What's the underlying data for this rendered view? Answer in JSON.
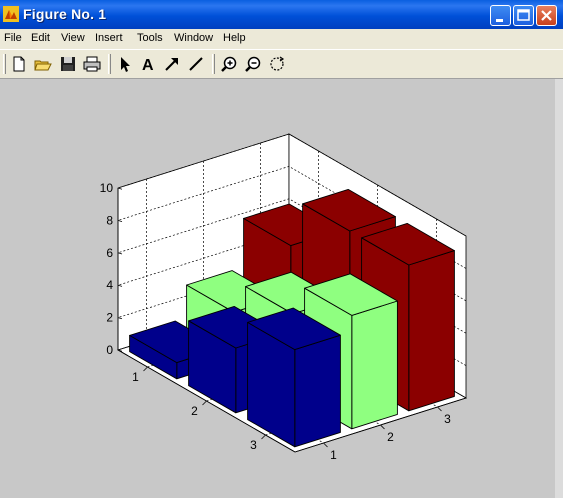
{
  "window": {
    "title": "Figure No. 1",
    "buttons": [
      "minimize",
      "maximize",
      "close"
    ]
  },
  "menu": [
    "File",
    "Edit",
    "View",
    "Insert",
    "Tools",
    "Window",
    "Help"
  ],
  "toolbar": [
    {
      "name": "new-figure-icon",
      "icon": "page"
    },
    {
      "name": "open-file-icon",
      "icon": "folder"
    },
    {
      "name": "save-icon",
      "icon": "floppy"
    },
    {
      "name": "print-icon",
      "icon": "printer"
    },
    {
      "name": "edit-plot-icon",
      "icon": "arrow-pointer"
    },
    {
      "name": "insert-text-icon",
      "icon": "letter-a"
    },
    {
      "name": "insert-arrow-icon",
      "icon": "diagonal-arrow"
    },
    {
      "name": "insert-line-icon",
      "icon": "line"
    },
    {
      "name": "zoom-in-icon",
      "icon": "magnifier-plus"
    },
    {
      "name": "zoom-out-icon",
      "icon": "magnifier-minus"
    },
    {
      "name": "rotate-3d-icon",
      "icon": "rotate"
    }
  ],
  "chart_data": {
    "type": "bar",
    "subtype": "bar3",
    "rows": [
      "1",
      "2",
      "3"
    ],
    "cols": [
      "1",
      "2",
      "3"
    ],
    "z_ticks": [
      "0",
      "2",
      "4",
      "6",
      "8",
      "10"
    ],
    "zlim": [
      0,
      10
    ],
    "grid": true,
    "series": [
      {
        "values": [
          [
            1,
            3,
            6
          ],
          [
            3,
            6,
            8
          ],
          [
            6,
            8,
            9
          ]
        ],
        "color": "#00008b"
      },
      {
        "values": [
          [
            4,
            5,
            9
          ]
        ],
        "color": "#8fff80"
      },
      {
        "values": [
          [
            6,
            7,
            9
          ]
        ],
        "color": "#8b0000"
      }
    ],
    "values": [
      [
        1,
        3,
        6
      ],
      [
        4,
        5,
        9
      ],
      [
        6,
        7,
        9
      ]
    ],
    "colors": {
      "row1": "#00008b",
      "row2": "#8fff80",
      "row3": "#8b0000"
    }
  }
}
